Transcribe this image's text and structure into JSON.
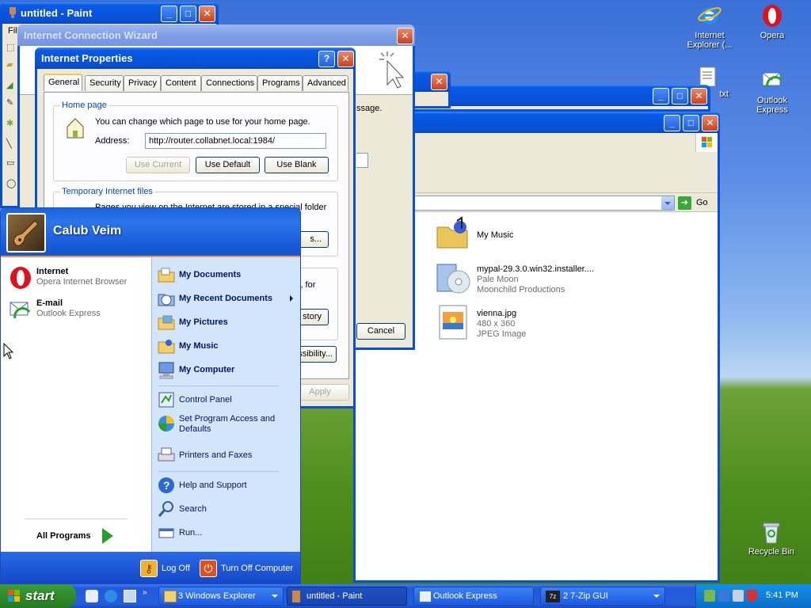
{
  "desktop": {
    "icons": [
      {
        "label": "Internet Explorer (...",
        "icon": "ie-icon"
      },
      {
        "label": "Opera",
        "icon": "opera-icon"
      },
      {
        "label": "txt",
        "icon": "text-file-icon"
      },
      {
        "label": "Outlook Express",
        "icon": "outlook-express-icon"
      },
      {
        "label": "Recycle Bin",
        "icon": "recycle-bin-icon"
      }
    ]
  },
  "paint": {
    "title": "untitled - Paint",
    "menu_first": "File"
  },
  "wizard": {
    "title": "Internet Connection Wizard",
    "message_fragment": "ssage.",
    "cancel": "Cancel"
  },
  "explorer": {
    "address_go": "Go",
    "files": [
      {
        "name": "My Music",
        "line2": "",
        "line3": ""
      },
      {
        "name": "mypal-29.3.0.win32.installer....",
        "line2": "Pale Moon",
        "line3": "Moonchild Productions"
      },
      {
        "name": "vienna.jpg",
        "line2": "480 x 360",
        "line3": "JPEG Image"
      }
    ]
  },
  "inetprops": {
    "title": "Internet Properties",
    "tabs": [
      "General",
      "Security",
      "Privacy",
      "Content",
      "Connections",
      "Programs",
      "Advanced"
    ],
    "home_group": "Home page",
    "home_desc": "You can change which page to use for your home page.",
    "address_label": "Address:",
    "address_value": "http://router.collabnet.local:1984/",
    "use_current": "Use Current",
    "use_default": "Use Default",
    "use_blank": "Use Blank",
    "temp_group": "Temporary Internet files",
    "temp_desc": "Pages you view on the Internet are stored in a special folder",
    "settings_frag": "s...",
    "for_frag": "l, for",
    "history_frag": "story",
    "accessibility_frag": "ssibility...",
    "apply": "Apply"
  },
  "startmenu": {
    "user": "Calub Veim",
    "pinned": [
      {
        "title": "Internet",
        "sub": "Opera Internet Browser"
      },
      {
        "title": "E-mail",
        "sub": "Outlook Express"
      }
    ],
    "all_programs": "All Programs",
    "right": [
      "My Documents",
      "My Recent Documents",
      "My Pictures",
      "My Music",
      "My Computer",
      "Control Panel",
      "Set Program Access and Defaults",
      "Printers and Faxes",
      "Help and Support",
      "Search",
      "Run..."
    ],
    "log_off": "Log Off",
    "turn_off": "Turn Off Computer"
  },
  "taskbar": {
    "start": "start",
    "tasks": [
      "3 Windows Explorer",
      "untitled - Paint",
      "Outlook Express",
      "2 7-Zip GUI"
    ],
    "clock": "5:41 PM"
  }
}
